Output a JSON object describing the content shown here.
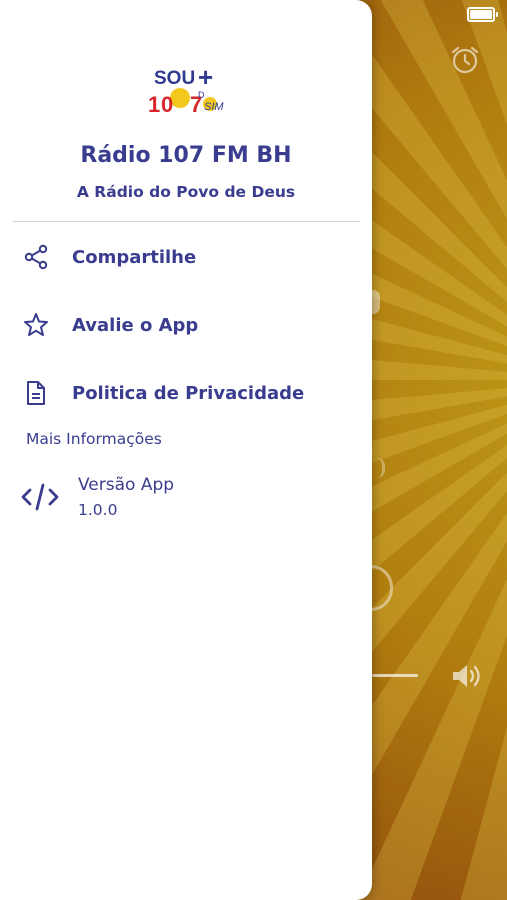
{
  "drawer": {
    "title": "Rádio 107 FM BH",
    "subtitle": "A Rádio do Povo de Deus",
    "logo_text": "SOU+ 107 D SIM",
    "items": [
      {
        "label": "Compartilhe",
        "icon": "share-icon"
      },
      {
        "label": "Avalie o App",
        "icon": "star-icon"
      },
      {
        "label": "Politica de Privacidade",
        "icon": "document-icon"
      }
    ],
    "section_label": "Mais Informações",
    "version": {
      "label": "Versão App",
      "value": "1.0.0",
      "icon": "code-icon"
    }
  },
  "colors": {
    "accent": "#3a3d8f",
    "background_gold": "#c98e12",
    "background_dark": "#7a3010"
  }
}
